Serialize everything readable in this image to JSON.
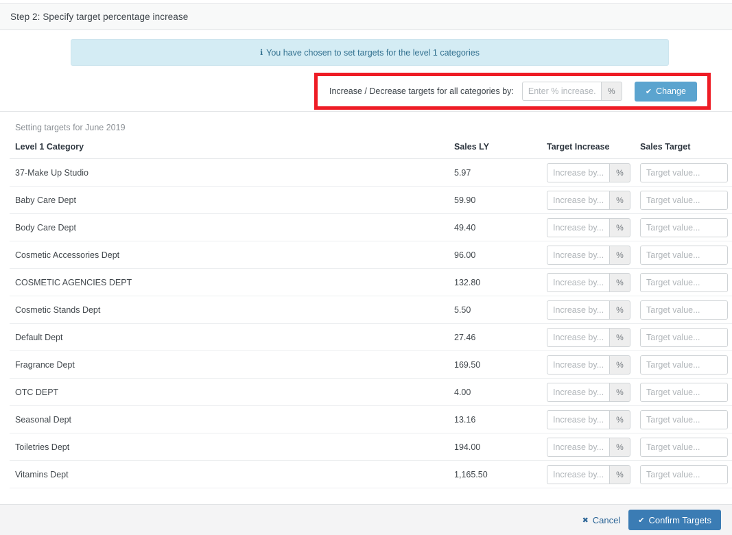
{
  "header": {
    "step_title": "Step 2: Specify target percentage increase"
  },
  "alert": {
    "icon": "info-icon",
    "glyph": "ℹ",
    "message": "You have chosen to set targets for the level 1 categories",
    "background_color": "#d4ecf4",
    "text_color": "#31708f"
  },
  "bulk_change": {
    "label": "Increase / Decrease targets for all categories by:",
    "input_placeholder": "Enter % increase...",
    "input_value": "",
    "addon_label": "%",
    "button_label": "Change",
    "button_icon": "check-icon",
    "button_glyph": "✔",
    "button_color": "#5ba4cf",
    "highlight_color": "#ee1c25"
  },
  "table": {
    "caption": "Setting targets for June 2019",
    "columns": [
      "Level 1 Category",
      "Sales LY",
      "Target Increase",
      "Sales Target"
    ],
    "increase_placeholder": "Increase by...",
    "percent_addon": "%",
    "target_placeholder": "Target value...",
    "rows": [
      {
        "category": "37-Make Up Studio",
        "sales_ly": "5.97",
        "target_increase": "",
        "sales_target": ""
      },
      {
        "category": "Baby Care Dept",
        "sales_ly": "59.90",
        "target_increase": "",
        "sales_target": ""
      },
      {
        "category": "Body Care Dept",
        "sales_ly": "49.40",
        "target_increase": "",
        "sales_target": ""
      },
      {
        "category": "Cosmetic Accessories Dept",
        "sales_ly": "96.00",
        "target_increase": "",
        "sales_target": ""
      },
      {
        "category": "COSMETIC AGENCIES DEPT",
        "sales_ly": "132.80",
        "target_increase": "",
        "sales_target": ""
      },
      {
        "category": "Cosmetic Stands Dept",
        "sales_ly": "5.50",
        "target_increase": "",
        "sales_target": ""
      },
      {
        "category": "Default Dept",
        "sales_ly": "27.46",
        "target_increase": "",
        "sales_target": ""
      },
      {
        "category": "Fragrance Dept",
        "sales_ly": "169.50",
        "target_increase": "",
        "sales_target": ""
      },
      {
        "category": "OTC DEPT",
        "sales_ly": "4.00",
        "target_increase": "",
        "sales_target": ""
      },
      {
        "category": "Seasonal Dept",
        "sales_ly": "13.16",
        "target_increase": "",
        "sales_target": ""
      },
      {
        "category": "Toiletries Dept",
        "sales_ly": "194.00",
        "target_increase": "",
        "sales_target": ""
      },
      {
        "category": "Vitamins Dept",
        "sales_ly": "1,165.50",
        "target_increase": "",
        "sales_target": ""
      }
    ]
  },
  "footer": {
    "cancel_label": "Cancel",
    "cancel_glyph": "✖",
    "confirm_label": "Confirm Targets",
    "confirm_glyph": "✔",
    "confirm_color": "#3b7cb4"
  }
}
